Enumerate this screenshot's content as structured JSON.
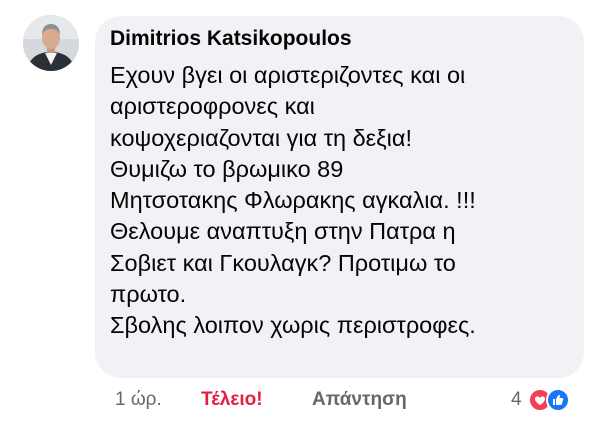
{
  "comment": {
    "author": "Dimitrios Katsikopoulos",
    "text_lines": [
      "Εχουν βγει οι αριστεριζοντες και οι",
      "αριστεροφρονες και",
      "κοψοχεριαζονται για τη δεξια!",
      "Θυμιζω το βρωμικο 89",
      "Μητσοτακης Φλωρακης αγκαλια. !!!",
      "Θελουμε αναπτυξη στην Πατρα η",
      "Σοβιετ και Γκουλαγκ? Προτιμω το",
      "πρωτο.",
      "Σβολης λοιπον χωρις περιστροφες."
    ]
  },
  "actions": {
    "time": "1 ώρ.",
    "reaction_label": "Τέλειο!",
    "reply_label": "Απάντηση",
    "reaction_count": "4",
    "reaction_icons": [
      "love-icon",
      "like-icon"
    ]
  },
  "colors": {
    "bubble": "#f0f2f5",
    "text": "#050505",
    "secondary": "#65676b",
    "love_reaction": "#e41e3f",
    "like_blue": "#1877f2"
  }
}
